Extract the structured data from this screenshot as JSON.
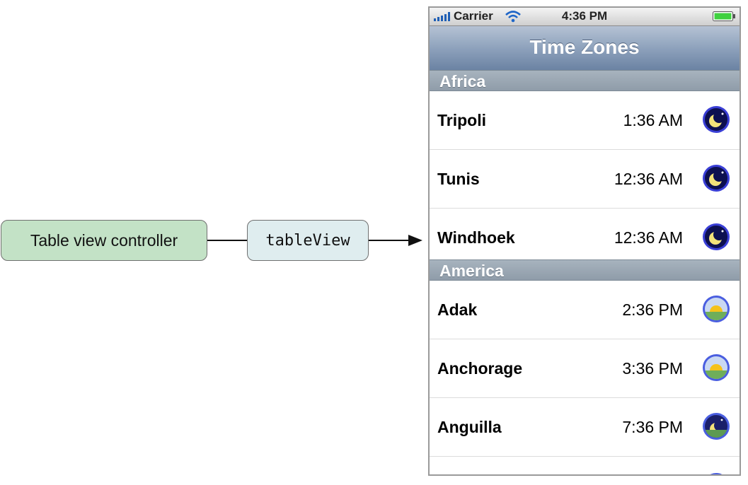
{
  "diagram": {
    "controller_label": "Table view controller",
    "outlet_label": "tableView"
  },
  "status_bar": {
    "carrier": "Carrier",
    "time": "4:36 PM",
    "icons": [
      "signal-icon",
      "wifi-icon",
      "battery-icon"
    ]
  },
  "nav": {
    "title": "Time Zones"
  },
  "sections": [
    {
      "header": "Africa",
      "rows": [
        {
          "city": "Tripoli",
          "time": "1:36 AM",
          "icon": "moon-icon"
        },
        {
          "city": "Tunis",
          "time": "12:36 AM",
          "icon": "moon-icon"
        },
        {
          "city": "Windhoek",
          "time": "12:36 AM",
          "icon": "moon-icon"
        }
      ]
    },
    {
      "header": "America",
      "rows": [
        {
          "city": "Adak",
          "time": "2:36 PM",
          "icon": "sun-icon"
        },
        {
          "city": "Anchorage",
          "time": "3:36 PM",
          "icon": "sun-icon"
        },
        {
          "city": "Anguilla",
          "time": "7:36 PM",
          "icon": "dusk-icon"
        }
      ]
    }
  ],
  "colors": {
    "controller_fill": "#c3e2c6",
    "outlet_fill": "#dfedef",
    "nav_bar": "#8ea2bc",
    "section_header": "#9aa6b2",
    "battery": "#3fd13f"
  }
}
